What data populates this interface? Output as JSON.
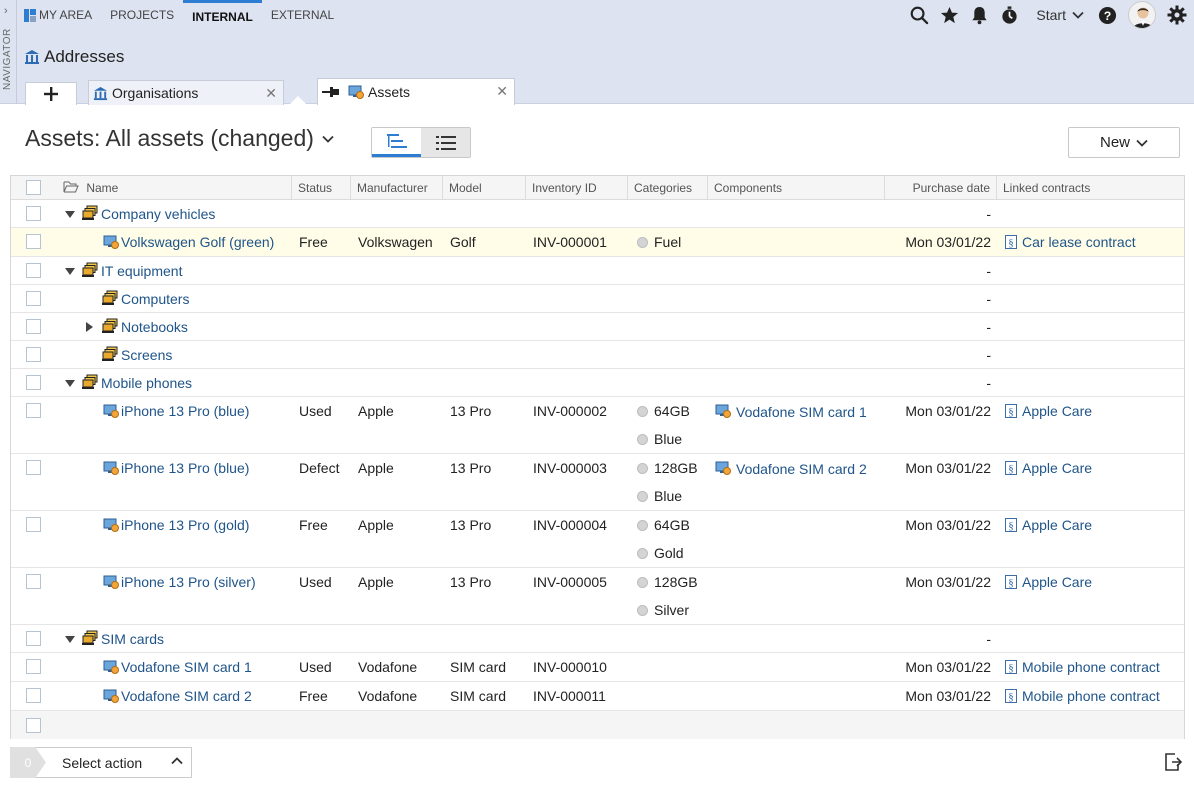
{
  "navigator": {
    "label": "NAVIGATOR"
  },
  "topnav": {
    "items": [
      {
        "label": "MY AREA"
      },
      {
        "label": "PROJECTS"
      },
      {
        "label": "INTERNAL"
      },
      {
        "label": "EXTERNAL"
      }
    ],
    "active_index": 2,
    "start_label": "Start"
  },
  "header": {
    "title": "Addresses"
  },
  "tabs": [
    {
      "label": "Organisations"
    },
    {
      "label": "Assets"
    }
  ],
  "page": {
    "title": "Assets: All assets (changed)",
    "new_label": "New"
  },
  "columns": {
    "name": "Name",
    "status": "Status",
    "manufacturer": "Manufacturer",
    "model": "Model",
    "inventory": "Inventory ID",
    "categories": "Categories",
    "components": "Components",
    "purchase": "Purchase date",
    "contracts": "Linked contracts"
  },
  "rows": [
    {
      "type": "group",
      "name": "Company vehicles",
      "purchase": "-"
    },
    {
      "type": "item",
      "name": "Volkswagen Golf (green)",
      "status": "Free",
      "manufacturer": "Volkswagen",
      "model": "Golf",
      "inventory": "INV-000001",
      "cat1": "Fuel",
      "purchase": "Mon 03/01/22",
      "contract": "Car lease contract"
    },
    {
      "type": "group",
      "name": "IT equipment",
      "purchase": "-"
    },
    {
      "type": "subgroup",
      "name": "Computers",
      "purchase": "-"
    },
    {
      "type": "subgroup",
      "name": "Notebooks",
      "purchase": "-"
    },
    {
      "type": "subgroup",
      "name": "Screens",
      "purchase": "-"
    },
    {
      "type": "group",
      "name": "Mobile phones",
      "purchase": "-"
    },
    {
      "type": "item",
      "name": "iPhone 13 Pro (blue)",
      "status": "Used",
      "manufacturer": "Apple",
      "model": "13 Pro",
      "inventory": "INV-000002",
      "cat1": "64GB",
      "cat2": "Blue",
      "component": "Vodafone SIM card 1",
      "purchase": "Mon 03/01/22",
      "contract": "Apple Care"
    },
    {
      "type": "item",
      "name": "iPhone 13 Pro (blue)",
      "status": "Defect",
      "manufacturer": "Apple",
      "model": "13 Pro",
      "inventory": "INV-000003",
      "cat1": "128GB",
      "cat2": "Blue",
      "component": "Vodafone SIM card 2",
      "purchase": "Mon 03/01/22",
      "contract": "Apple Care"
    },
    {
      "type": "item",
      "name": "iPhone 13 Pro (gold)",
      "status": "Free",
      "manufacturer": "Apple",
      "model": "13 Pro",
      "inventory": "INV-000004",
      "cat1": "64GB",
      "cat2": "Gold",
      "purchase": "Mon 03/01/22",
      "contract": "Apple Care"
    },
    {
      "type": "item",
      "name": "iPhone 13 Pro (silver)",
      "status": "Used",
      "manufacturer": "Apple",
      "model": "13 Pro",
      "inventory": "INV-000005",
      "cat1": "128GB",
      "cat2": "Silver",
      "purchase": "Mon 03/01/22",
      "contract": "Apple Care"
    },
    {
      "type": "group",
      "name": "SIM cards",
      "purchase": "-"
    },
    {
      "type": "item",
      "name": "Vodafone SIM card 1",
      "status": "Used",
      "manufacturer": "Vodafone",
      "model": "SIM card",
      "inventory": "INV-000010",
      "purchase": "Mon 03/01/22",
      "contract": "Mobile phone contract"
    },
    {
      "type": "item",
      "name": "Vodafone SIM card 2",
      "status": "Free",
      "manufacturer": "Vodafone",
      "model": "SIM card",
      "inventory": "INV-000011",
      "purchase": "Mon 03/01/22",
      "contract": "Mobile phone contract"
    }
  ],
  "actions": {
    "count": "0",
    "label": "Select action"
  },
  "colors": {
    "accent": "#2d7dd2",
    "link": "#20558a",
    "header_bg": "#dde3f0",
    "highlight_row": "#fffde8"
  }
}
